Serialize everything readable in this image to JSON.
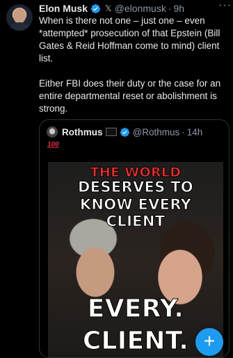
{
  "author": {
    "name": "Elon Musk",
    "handle": "@elonmusk",
    "time": "9h",
    "x_logo": "𝕏",
    "verified_icon": "verified-badge-icon",
    "more_label": "···"
  },
  "tweet": {
    "paragraph1": "When is there not one – just one – even *attempted* prosecution of that Epstein (Bill Gates & Reid Hoffman come to mind) client list.",
    "paragraph2": "Either FBI does their duty or the case for an entire departmental reset or abolishment is strong."
  },
  "quote": {
    "name": "Rothmus",
    "handle": "@Rothmus",
    "time": "14h",
    "emoji": "100",
    "image_text": {
      "line1": "THE WORLD",
      "line2": "DESERVES TO",
      "line3": "KNOW EVERY CLIENT",
      "line4": "EVERY.",
      "line5": "CLIENT."
    }
  },
  "compose_button": {
    "label": "+"
  },
  "colors": {
    "background": "#000000",
    "text": "#e7e9ea",
    "secondary": "#8b98a5",
    "accent": "#1d9bf0",
    "headline_red": "#ff2b2b"
  }
}
